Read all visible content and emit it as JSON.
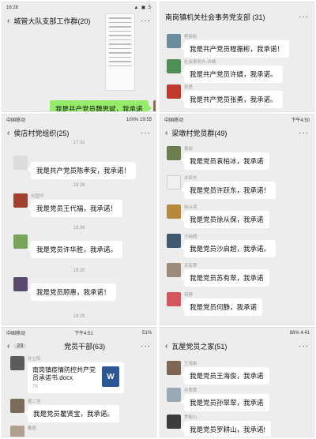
{
  "p1": {
    "status": {
      "time": "16:28",
      "right": "▲ ◼ 5"
    },
    "nav": {
      "title": "城管大队支部工作群(20)",
      "more": "···"
    },
    "messages": [
      {
        "text": "我是共产党员魏思斌，我承诺"
      }
    ]
  },
  "p2": {
    "nav": {
      "title": "南岗镇机关社会事务党支部 (31)",
      "more": "···"
    },
    "messages": [
      {
        "who": "程振彬",
        "text": "我是共产党员程振彬，我承诺！"
      },
      {
        "who": "社会事务办-许婧",
        "text": "我是共产党员许婧，我承诺。"
      },
      {
        "who": "张勇",
        "text": "我是共产党员张勇，我承诺。"
      }
    ]
  },
  "p3": {
    "status": {
      "left": "中国移动",
      "right": "100% 19:55"
    },
    "nav": {
      "title": "侯店村党组织(25)",
      "more": "···"
    },
    "times": [
      "17:32",
      "18:28",
      "18:36",
      "19:20",
      "19:25"
    ],
    "messages": [
      {
        "who": "",
        "text": "我是共产党员陈孝安，我承诺！"
      },
      {
        "who": "何国华",
        "text": "我是党员王代福，我承诺！"
      },
      {
        "who": "",
        "text": "我是党员许华胜，我承诺。"
      },
      {
        "who": "",
        "text": "我是党员顾惠，我承诺！"
      }
    ]
  },
  "p4": {
    "status": {
      "left": "中国移动",
      "right": "下午4:50"
    },
    "nav": {
      "title": "梁墩村党员群(49)",
      "more": "···"
    },
    "messages": [
      {
        "who": "袁柏",
        "text": "我是党员袁柏冰，我承诺"
      },
      {
        "who": "许跃东",
        "text": "我是党员许跃东，我承诺！"
      },
      {
        "who": "徐从保",
        "text": "我是党员徐从保，我承诺"
      },
      {
        "who": "沙启超",
        "text": "我是党员沙启超，我承诺。"
      },
      {
        "who": "苏有翠",
        "text": "我是党员苏有翠，我承诺"
      },
      {
        "who": "何静",
        "text": "我是党员何静，我承诺"
      }
    ]
  },
  "p5": {
    "status": {
      "left": "中国移动",
      "center": "下午4:51",
      "right": "51%"
    },
    "nav": {
      "badge": "23",
      "title": "党员干部(63)",
      "more": "···"
    },
    "file": {
      "who": "孙立阳",
      "title": "南岗镇疫情防控共产党员承诺书.docx",
      "size": "7K",
      "icon": "W"
    },
    "messages": [
      {
        "who": "瞿二宝",
        "text": "我是党员瞿贤宝，我承诺。"
      },
      {
        "who": "戴君",
        "text": ""
      }
    ]
  },
  "p6": {
    "status": {
      "right": "88% 4:41"
    },
    "nav": {
      "title": "瓦屋党员之家(51)",
      "more": "···"
    },
    "messages": [
      {
        "who": "王海俊",
        "text": "我是党员王海俊，我承诺"
      },
      {
        "who": "孙翠翠",
        "text": "我是党员孙翠翠，我承诺"
      },
      {
        "who": "罗耕山",
        "text": "我是党员罗耕山，我承诺!"
      }
    ]
  }
}
